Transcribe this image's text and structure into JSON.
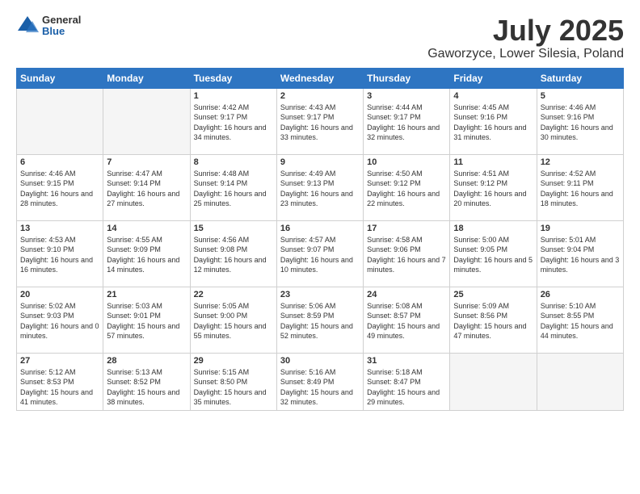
{
  "header": {
    "logo_general": "General",
    "logo_blue": "Blue",
    "title": "July 2025",
    "subtitle": "Gaworzyce, Lower Silesia, Poland"
  },
  "weekdays": [
    "Sunday",
    "Monday",
    "Tuesday",
    "Wednesday",
    "Thursday",
    "Friday",
    "Saturday"
  ],
  "weeks": [
    [
      {
        "day": "",
        "sunrise": "",
        "sunset": "",
        "daylight": ""
      },
      {
        "day": "",
        "sunrise": "",
        "sunset": "",
        "daylight": ""
      },
      {
        "day": "1",
        "sunrise": "Sunrise: 4:42 AM",
        "sunset": "Sunset: 9:17 PM",
        "daylight": "Daylight: 16 hours and 34 minutes."
      },
      {
        "day": "2",
        "sunrise": "Sunrise: 4:43 AM",
        "sunset": "Sunset: 9:17 PM",
        "daylight": "Daylight: 16 hours and 33 minutes."
      },
      {
        "day": "3",
        "sunrise": "Sunrise: 4:44 AM",
        "sunset": "Sunset: 9:17 PM",
        "daylight": "Daylight: 16 hours and 32 minutes."
      },
      {
        "day": "4",
        "sunrise": "Sunrise: 4:45 AM",
        "sunset": "Sunset: 9:16 PM",
        "daylight": "Daylight: 16 hours and 31 minutes."
      },
      {
        "day": "5",
        "sunrise": "Sunrise: 4:46 AM",
        "sunset": "Sunset: 9:16 PM",
        "daylight": "Daylight: 16 hours and 30 minutes."
      }
    ],
    [
      {
        "day": "6",
        "sunrise": "Sunrise: 4:46 AM",
        "sunset": "Sunset: 9:15 PM",
        "daylight": "Daylight: 16 hours and 28 minutes."
      },
      {
        "day": "7",
        "sunrise": "Sunrise: 4:47 AM",
        "sunset": "Sunset: 9:14 PM",
        "daylight": "Daylight: 16 hours and 27 minutes."
      },
      {
        "day": "8",
        "sunrise": "Sunrise: 4:48 AM",
        "sunset": "Sunset: 9:14 PM",
        "daylight": "Daylight: 16 hours and 25 minutes."
      },
      {
        "day": "9",
        "sunrise": "Sunrise: 4:49 AM",
        "sunset": "Sunset: 9:13 PM",
        "daylight": "Daylight: 16 hours and 23 minutes."
      },
      {
        "day": "10",
        "sunrise": "Sunrise: 4:50 AM",
        "sunset": "Sunset: 9:12 PM",
        "daylight": "Daylight: 16 hours and 22 minutes."
      },
      {
        "day": "11",
        "sunrise": "Sunrise: 4:51 AM",
        "sunset": "Sunset: 9:12 PM",
        "daylight": "Daylight: 16 hours and 20 minutes."
      },
      {
        "day": "12",
        "sunrise": "Sunrise: 4:52 AM",
        "sunset": "Sunset: 9:11 PM",
        "daylight": "Daylight: 16 hours and 18 minutes."
      }
    ],
    [
      {
        "day": "13",
        "sunrise": "Sunrise: 4:53 AM",
        "sunset": "Sunset: 9:10 PM",
        "daylight": "Daylight: 16 hours and 16 minutes."
      },
      {
        "day": "14",
        "sunrise": "Sunrise: 4:55 AM",
        "sunset": "Sunset: 9:09 PM",
        "daylight": "Daylight: 16 hours and 14 minutes."
      },
      {
        "day": "15",
        "sunrise": "Sunrise: 4:56 AM",
        "sunset": "Sunset: 9:08 PM",
        "daylight": "Daylight: 16 hours and 12 minutes."
      },
      {
        "day": "16",
        "sunrise": "Sunrise: 4:57 AM",
        "sunset": "Sunset: 9:07 PM",
        "daylight": "Daylight: 16 hours and 10 minutes."
      },
      {
        "day": "17",
        "sunrise": "Sunrise: 4:58 AM",
        "sunset": "Sunset: 9:06 PM",
        "daylight": "Daylight: 16 hours and 7 minutes."
      },
      {
        "day": "18",
        "sunrise": "Sunrise: 5:00 AM",
        "sunset": "Sunset: 9:05 PM",
        "daylight": "Daylight: 16 hours and 5 minutes."
      },
      {
        "day": "19",
        "sunrise": "Sunrise: 5:01 AM",
        "sunset": "Sunset: 9:04 PM",
        "daylight": "Daylight: 16 hours and 3 minutes."
      }
    ],
    [
      {
        "day": "20",
        "sunrise": "Sunrise: 5:02 AM",
        "sunset": "Sunset: 9:03 PM",
        "daylight": "Daylight: 16 hours and 0 minutes."
      },
      {
        "day": "21",
        "sunrise": "Sunrise: 5:03 AM",
        "sunset": "Sunset: 9:01 PM",
        "daylight": "Daylight: 15 hours and 57 minutes."
      },
      {
        "day": "22",
        "sunrise": "Sunrise: 5:05 AM",
        "sunset": "Sunset: 9:00 PM",
        "daylight": "Daylight: 15 hours and 55 minutes."
      },
      {
        "day": "23",
        "sunrise": "Sunrise: 5:06 AM",
        "sunset": "Sunset: 8:59 PM",
        "daylight": "Daylight: 15 hours and 52 minutes."
      },
      {
        "day": "24",
        "sunrise": "Sunrise: 5:08 AM",
        "sunset": "Sunset: 8:57 PM",
        "daylight": "Daylight: 15 hours and 49 minutes."
      },
      {
        "day": "25",
        "sunrise": "Sunrise: 5:09 AM",
        "sunset": "Sunset: 8:56 PM",
        "daylight": "Daylight: 15 hours and 47 minutes."
      },
      {
        "day": "26",
        "sunrise": "Sunrise: 5:10 AM",
        "sunset": "Sunset: 8:55 PM",
        "daylight": "Daylight: 15 hours and 44 minutes."
      }
    ],
    [
      {
        "day": "27",
        "sunrise": "Sunrise: 5:12 AM",
        "sunset": "Sunset: 8:53 PM",
        "daylight": "Daylight: 15 hours and 41 minutes."
      },
      {
        "day": "28",
        "sunrise": "Sunrise: 5:13 AM",
        "sunset": "Sunset: 8:52 PM",
        "daylight": "Daylight: 15 hours and 38 minutes."
      },
      {
        "day": "29",
        "sunrise": "Sunrise: 5:15 AM",
        "sunset": "Sunset: 8:50 PM",
        "daylight": "Daylight: 15 hours and 35 minutes."
      },
      {
        "day": "30",
        "sunrise": "Sunrise: 5:16 AM",
        "sunset": "Sunset: 8:49 PM",
        "daylight": "Daylight: 15 hours and 32 minutes."
      },
      {
        "day": "31",
        "sunrise": "Sunrise: 5:18 AM",
        "sunset": "Sunset: 8:47 PM",
        "daylight": "Daylight: 15 hours and 29 minutes."
      },
      {
        "day": "",
        "sunrise": "",
        "sunset": "",
        "daylight": ""
      },
      {
        "day": "",
        "sunrise": "",
        "sunset": "",
        "daylight": ""
      }
    ]
  ]
}
